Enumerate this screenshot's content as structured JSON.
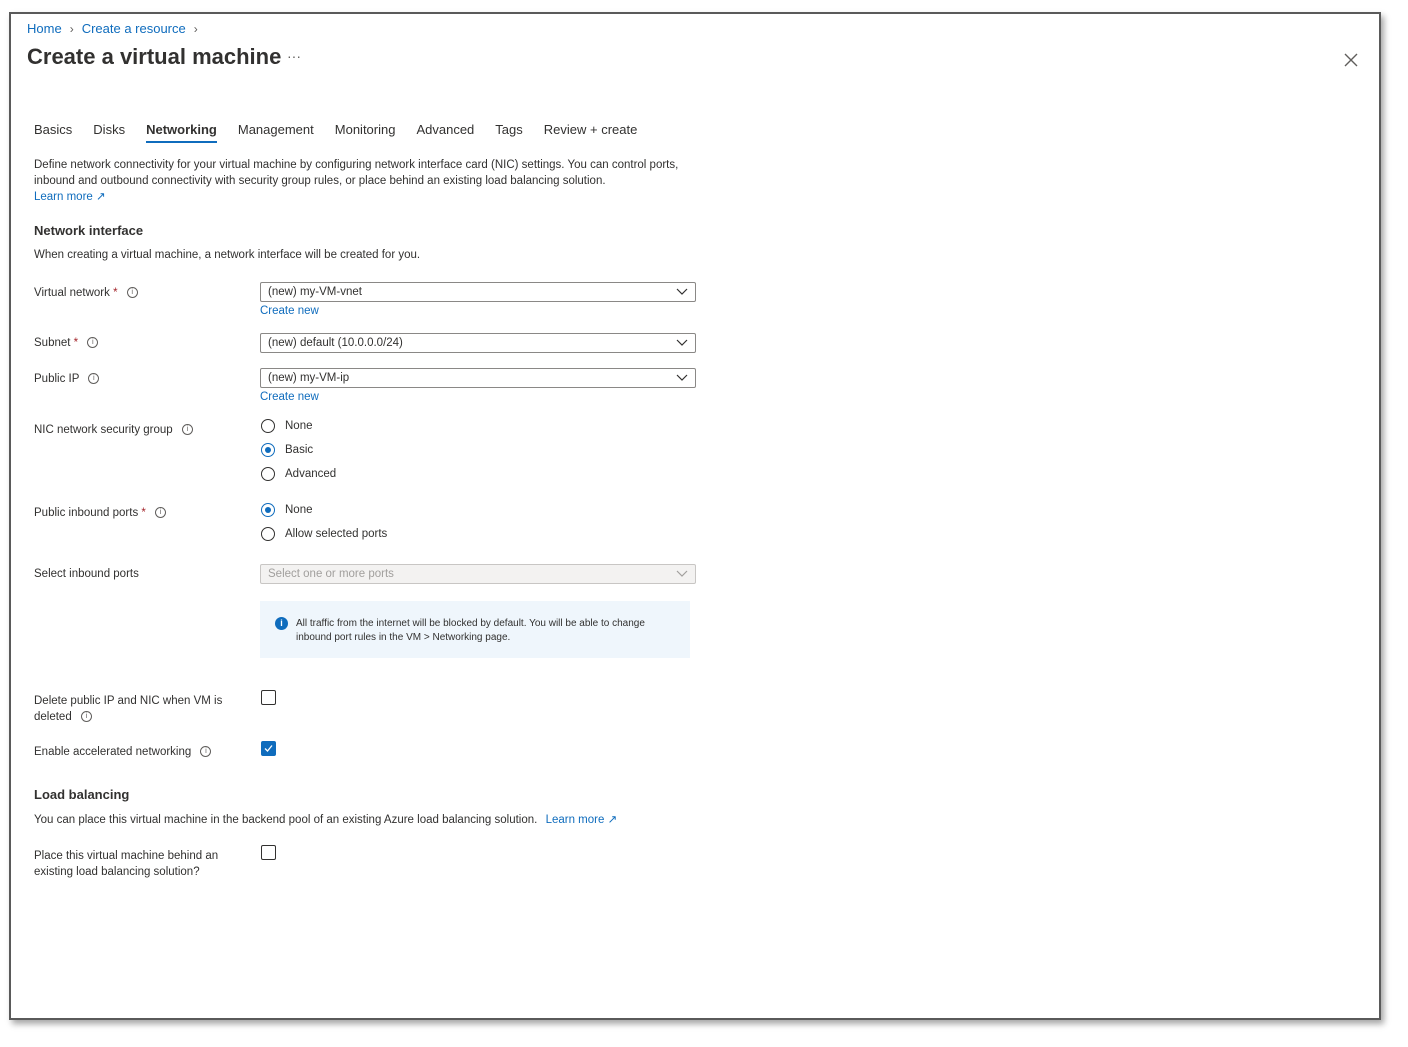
{
  "breadcrumb": [
    "Home",
    "Create a resource"
  ],
  "title": "Create a virtual machine",
  "more_label": "···",
  "tabs": [
    "Basics",
    "Disks",
    "Networking",
    "Management",
    "Monitoring",
    "Advanced",
    "Tags",
    "Review + create"
  ],
  "active_tab": "Networking",
  "description": "Define network connectivity for your virtual machine by configuring network interface card (NIC) settings. You can control ports, inbound and outbound connectivity with security group rules, or place behind an existing load balancing solution.",
  "learn_more": "Learn more",
  "network_interface": {
    "heading": "Network interface",
    "intro": "When creating a virtual machine, a network interface will be created for you.",
    "virtual_network": {
      "label": "Virtual network",
      "value": "(new) my-VM-vnet",
      "create_new": "Create new"
    },
    "subnet": {
      "label": "Subnet",
      "value": "(new) default (10.0.0.0/24)"
    },
    "public_ip": {
      "label": "Public IP",
      "value": "(new) my-VM-ip",
      "create_new": "Create new"
    },
    "nic_nsg": {
      "label": "NIC network security group",
      "options": [
        "None",
        "Basic",
        "Advanced"
      ],
      "selected": "Basic"
    },
    "public_inbound_ports": {
      "label": "Public inbound ports",
      "options": [
        "None",
        "Allow selected ports"
      ],
      "selected": "None"
    },
    "select_inbound_ports": {
      "label": "Select inbound ports",
      "placeholder": "Select one or more ports"
    },
    "info_message": "All traffic from the internet will be blocked by default. You will be able to change inbound port rules in the VM > Networking page.",
    "delete_public_ip": {
      "label": "Delete public IP and NIC when VM is deleted",
      "checked": false
    },
    "accelerated_networking": {
      "label": "Enable accelerated networking",
      "checked": true
    }
  },
  "load_balancing": {
    "heading": "Load balancing",
    "intro": "You can place this virtual machine in the backend pool of an existing Azure load balancing solution.",
    "learn_more": "Learn more",
    "place_behind": {
      "label": "Place this virtual machine behind an existing load balancing solution?",
      "checked": false
    }
  },
  "colors": {
    "accent": "#0f6cbd",
    "required": "#a4262c",
    "info_bg": "#eff6fc"
  }
}
